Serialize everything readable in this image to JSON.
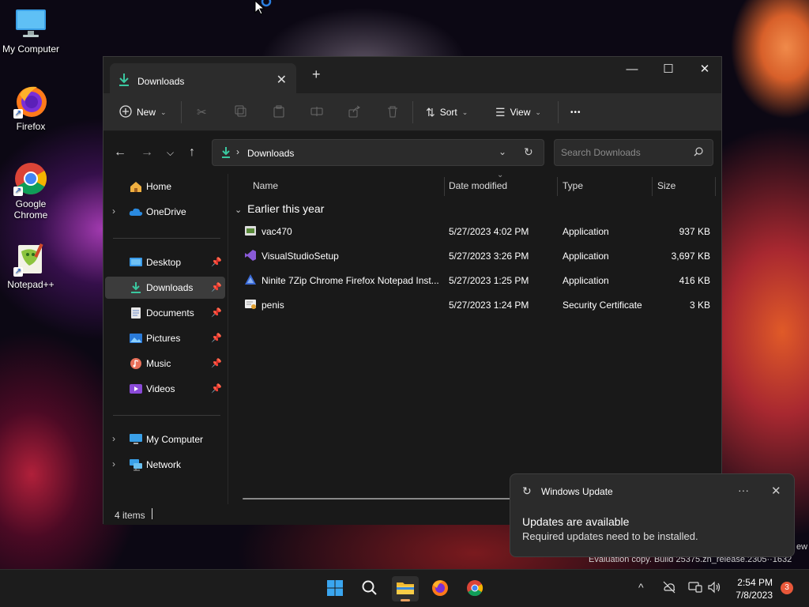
{
  "desktop": {
    "icons": [
      {
        "label": "My Computer"
      },
      {
        "label": "Firefox"
      },
      {
        "label": "Google Chrome"
      },
      {
        "label": "Notepad++"
      }
    ]
  },
  "window": {
    "tab_title": "Downloads",
    "tab_close": "✕",
    "new_tab": "+",
    "controls": {
      "minimize": "—",
      "maximize": "☐",
      "close": "✕"
    },
    "toolbar": {
      "new_label": "New",
      "sort_label": "Sort",
      "view_label": "View",
      "more_label": "•••"
    },
    "address": {
      "crumb": "Downloads",
      "search_placeholder": "Search Downloads"
    },
    "nav": {
      "home": "Home",
      "onedrive": "OneDrive",
      "desktop": "Desktop",
      "downloads": "Downloads",
      "documents": "Documents",
      "pictures": "Pictures",
      "music": "Music",
      "videos": "Videos",
      "my_computer": "My Computer",
      "network": "Network"
    },
    "columns": {
      "name": "Name",
      "date": "Date modified",
      "type": "Type",
      "size": "Size"
    },
    "group_label": "Earlier this year",
    "files": [
      {
        "name": "vac470",
        "date": "5/27/2023 4:02 PM",
        "type": "Application",
        "size": "937 KB"
      },
      {
        "name": "VisualStudioSetup",
        "date": "5/27/2023 3:26 PM",
        "type": "Application",
        "size": "3,697 KB"
      },
      {
        "name": "Ninite 7Zip Chrome Firefox Notepad Inst...",
        "date": "5/27/2023 1:25 PM",
        "type": "Application",
        "size": "416 KB"
      },
      {
        "name": "penis",
        "date": "5/27/2023 1:24 PM",
        "type": "Security Certificate",
        "size": "3 KB"
      }
    ],
    "status": "4 items"
  },
  "toast": {
    "app": "Windows Update",
    "heading": "Updates are available",
    "body": "Required updates need to be installed.",
    "more": "···",
    "close": "✕"
  },
  "watermark": {
    "line2": "Evaluation copy. Build 25375.zn_release.2305··1632",
    "line1_tail": "ew"
  },
  "taskbar": {
    "time": "2:54 PM",
    "date": "7/8/2023",
    "notification_count": "3"
  }
}
